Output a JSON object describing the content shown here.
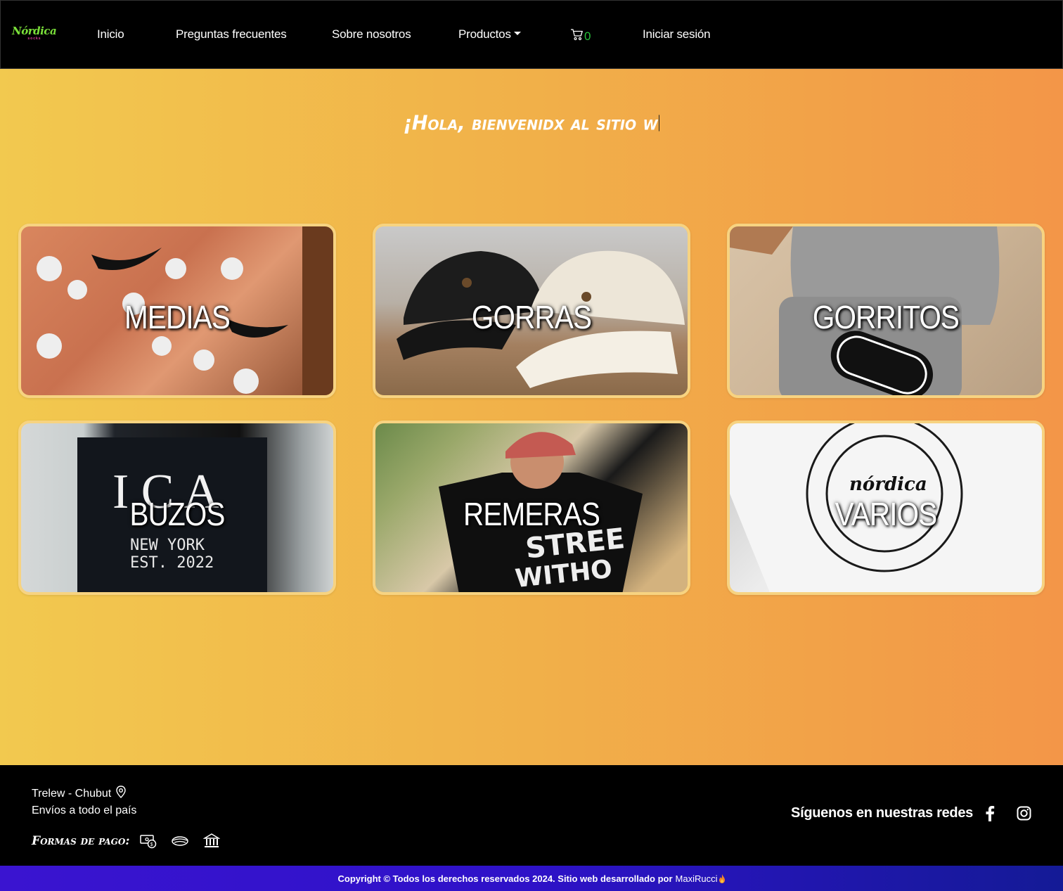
{
  "brand": {
    "name": "Nórdica",
    "sub": "socks"
  },
  "nav": {
    "inicio": "Inicio",
    "faq": "Preguntas frecuentes",
    "about": "Sobre nosotros",
    "productos": "Productos",
    "cart_count": "0",
    "login": "Iniciar sesión"
  },
  "hero": {
    "welcome": "¡Hola, bienvenidx al sitio w"
  },
  "categories": [
    {
      "label": "MEDIAS"
    },
    {
      "label": "GORRAS"
    },
    {
      "label": "GORRITOS"
    },
    {
      "label": "BUZOS"
    },
    {
      "label": "REMERAS"
    },
    {
      "label": "VARIOS"
    }
  ],
  "footer": {
    "location": "Trelew - Chubut",
    "shipping": "Envíos a todo el país",
    "payment_label": "Formas de pago:",
    "follow": "Síguenos en nuestras redes",
    "copyright": "Copyright © Todos los derechos reservados 2024. Sitio web desarrollado por",
    "author": "MaxiRucci"
  },
  "icons": [
    "cart-icon",
    "location-pin-icon",
    "cash-icon",
    "card-icon",
    "bank-icon",
    "facebook-icon",
    "instagram-icon",
    "fire-icon"
  ],
  "colors": {
    "accent_green": "#27c23a",
    "gradient_start": "#f2c94f",
    "gradient_end": "#f39648",
    "card_border": "#f7d381",
    "copyright_bg": "#3a14d0"
  }
}
